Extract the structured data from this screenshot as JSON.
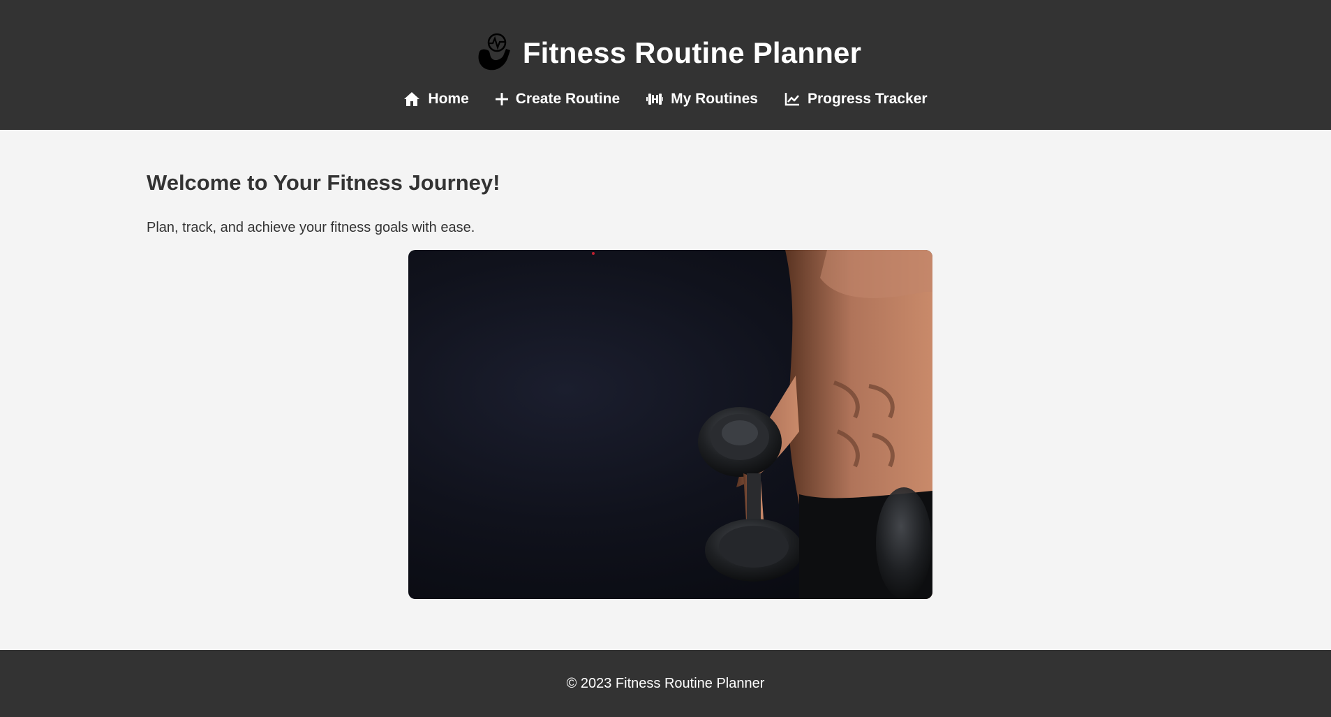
{
  "app": {
    "title": "Fitness Routine Planner"
  },
  "nav": {
    "items": [
      {
        "label": "Home",
        "icon": "home-icon"
      },
      {
        "label": "Create Routine",
        "icon": "plus-icon"
      },
      {
        "label": "My Routines",
        "icon": "dumbbell-icon"
      },
      {
        "label": "Progress Tracker",
        "icon": "chart-line-icon"
      }
    ]
  },
  "main": {
    "heading": "Welcome to Your Fitness Journey!",
    "tagline": "Plan, track, and achieve your fitness goals with ease.",
    "hero_image": "muscular man lifting dumbbell on dark background"
  },
  "footer": {
    "copyright": "© 2023 Fitness Routine Planner"
  },
  "colors": {
    "header_bg": "#333333",
    "page_bg": "#f4f4f4",
    "text": "#333333"
  }
}
